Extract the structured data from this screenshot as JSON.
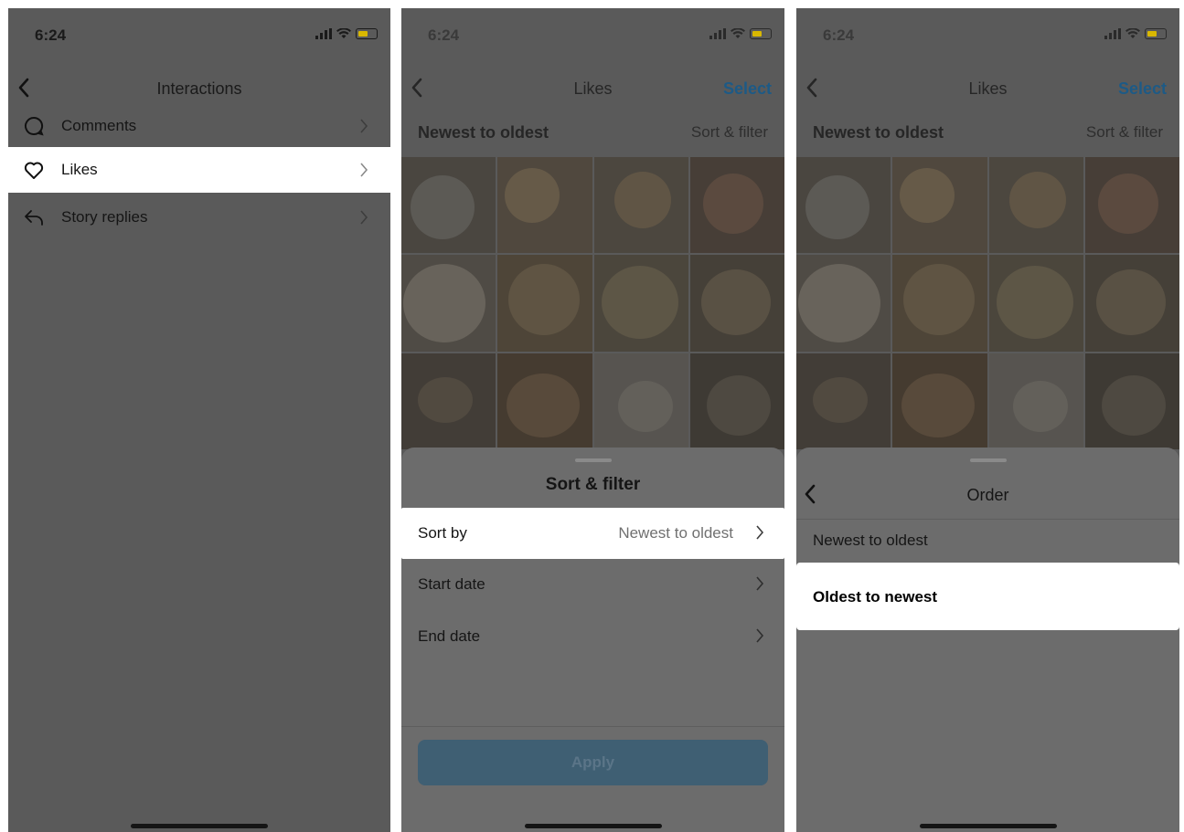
{
  "status": {
    "time": "6:24"
  },
  "colors": {
    "overlay": "#5a5a5a",
    "highlight": "#ffffff",
    "battery": "#d9b800",
    "link": "#1d5a86"
  },
  "screen1": {
    "title": "Interactions",
    "items": [
      {
        "label": "Comments",
        "icon": "comment-bubble-icon"
      },
      {
        "label": "Likes",
        "icon": "heart-icon"
      },
      {
        "label": "Story replies",
        "icon": "reply-arrow-icon"
      }
    ]
  },
  "screen2": {
    "title": "Likes",
    "select": "Select",
    "sort_current": "Newest to oldest",
    "sort_filter_link": "Sort & filter",
    "sheet": {
      "title": "Sort & filter",
      "rows": [
        {
          "label": "Sort by",
          "value": "Newest to oldest"
        },
        {
          "label": "Start date",
          "value": ""
        },
        {
          "label": "End date",
          "value": ""
        }
      ],
      "apply": "Apply"
    }
  },
  "screen3": {
    "title": "Likes",
    "select": "Select",
    "sort_current": "Newest to oldest",
    "sort_filter_link": "Sort & filter",
    "sheet": {
      "title": "Order",
      "options": [
        "Newest to oldest",
        "Oldest to newest"
      ]
    }
  }
}
